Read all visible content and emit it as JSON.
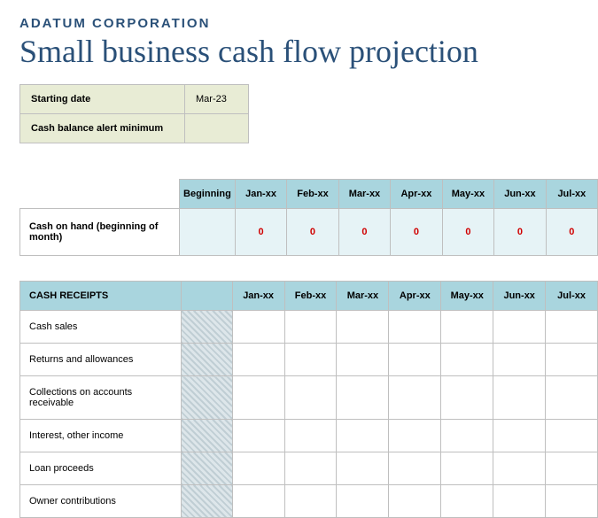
{
  "company": "ADATUM CORPORATION",
  "title": "Small business cash flow projection",
  "info": {
    "starting_date_label": "Starting date",
    "starting_date_value": "Mar-23",
    "alert_min_label": "Cash balance alert minimum",
    "alert_min_value": ""
  },
  "months_header": {
    "beginning": "Beginning",
    "cols": [
      "Jan-xx",
      "Feb-xx",
      "Mar-xx",
      "Apr-xx",
      "May-xx",
      "Jun-xx",
      "Jul-xx"
    ]
  },
  "cash_on_hand": {
    "label": "Cash on hand (beginning of month)",
    "beginning": "",
    "values": [
      "0",
      "0",
      "0",
      "0",
      "0",
      "0",
      "0"
    ]
  },
  "receipts": {
    "section_label": "CASH RECEIPTS",
    "cols": [
      "Jan-xx",
      "Feb-xx",
      "Mar-xx",
      "Apr-xx",
      "May-xx",
      "Jun-xx",
      "Jul-xx"
    ],
    "rows": [
      "Cash sales",
      "Returns and allowances",
      "Collections on accounts receivable",
      "Interest, other income",
      "Loan proceeds",
      "Owner contributions"
    ]
  }
}
